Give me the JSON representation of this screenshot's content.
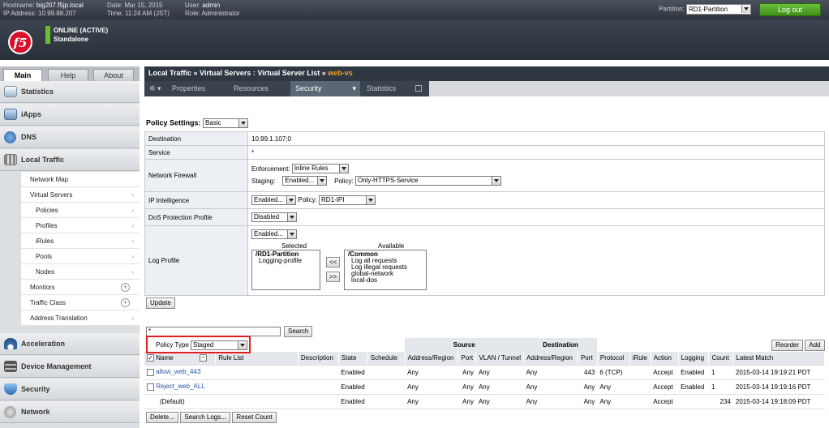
{
  "header": {
    "hostname_label": "Hostname:",
    "hostname": "big207.f5jp.local",
    "ip_label": "IP Address:",
    "ip": "10.99.88.207",
    "date_label": "Date:",
    "date": "Mar 15, 2015",
    "time_label": "Time:",
    "time": "11:24 AM (JST)",
    "user_label": "User:",
    "user": "admin",
    "role_label": "Role:",
    "role": "Administrator",
    "partition_label": "Partition:",
    "partition": "RD1-Partition",
    "logout": "Log out",
    "status_line1": "ONLINE (ACTIVE)",
    "status_line2": "Standalone",
    "logo": "f5"
  },
  "left_tabs": [
    "Main",
    "Help",
    "About"
  ],
  "nav": {
    "statistics": "Statistics",
    "iapps": "iApps",
    "dns": "DNS",
    "local_traffic": "Local Traffic",
    "items": [
      "Network Map",
      "Virtual Servers",
      "Policies",
      "Profiles",
      "iRules",
      "Pools",
      "Nodes",
      "Monitors",
      "Traffic Class",
      "Address Translation"
    ],
    "acceleration": "Acceleration",
    "device_management": "Device Management",
    "security": "Security",
    "network": "Network"
  },
  "breadcrumb": {
    "path": "Local Traffic » Virtual Servers : Virtual Server List »",
    "current": "web-vs"
  },
  "tabs": [
    "Properties",
    "Resources",
    "Security",
    "Statistics"
  ],
  "policy_settings": {
    "label": "Policy Settings:",
    "mode": "Basic"
  },
  "rows": {
    "destination": {
      "label": "Destination",
      "value": "10.99.1.107:0"
    },
    "service": {
      "label": "Service",
      "value": "*"
    },
    "firewall": {
      "label": "Network Firewall",
      "enforcement_label": "Enforcement:",
      "enforcement": "Inline Rules",
      "staging_label": "Staging:",
      "staging": "Enabled...",
      "policy_label": "Policy:",
      "policy": "Only-HTTPS-Service"
    },
    "ip_intel": {
      "label": "IP Intelligence",
      "value": "Enabled...",
      "policy_label": "Policy:",
      "policy": "RD1-IPI"
    },
    "dos": {
      "label": "DoS Protection Profile",
      "value": "Disabled"
    },
    "log": {
      "label": "Log Profile",
      "value": "Enabled...",
      "selected_label": "Selected",
      "available_label": "Available",
      "selected": [
        "/RD1-Partition",
        "Logging-profile"
      ],
      "available": [
        "/Common",
        "Log all requests",
        "Log illegal requests",
        "global-network",
        "local-dos"
      ],
      "move_left": "<<",
      "move_right": ">>"
    }
  },
  "update": "Update",
  "search_button": "Search",
  "search_value": "*",
  "policy_type_label": "Policy Type",
  "policy_type": "Staged",
  "group_headers": {
    "source": "Source",
    "destination": "Destination"
  },
  "reorder": "Reorder",
  "add": "Add",
  "columns": [
    "Name",
    "Rule List",
    "Description",
    "State",
    "Schedule",
    "Address/Region",
    "Port",
    "VLAN / Tunnel",
    "Address/Region",
    "Port",
    "Protocol",
    "iRule",
    "Action",
    "Logging",
    "Count",
    "Latest Match"
  ],
  "rules": [
    {
      "name": "allow_web_443",
      "state": "Enabled",
      "src_addr": "Any",
      "src_port": "Any",
      "vlan": "Any",
      "dst_addr": "Any",
      "dst_port": "443",
      "protocol": "6 (TCP)",
      "action": "Accept",
      "logging": "Enabled",
      "count": "1",
      "latest": "2015-03-14 19:19:21 PDT"
    },
    {
      "name": "Reject_web_ALL",
      "state": "Enabled",
      "src_addr": "Any",
      "src_port": "Any",
      "vlan": "Any",
      "dst_addr": "Any",
      "dst_port": "Any",
      "protocol": "Any",
      "action": "Accept",
      "logging": "Enabled",
      "count": "1",
      "latest": "2015-03-14 19:19:16 PDT"
    },
    {
      "name": "(Default)",
      "state": "Enabled",
      "src_addr": "Any",
      "src_port": "Any",
      "vlan": "Any",
      "dst_addr": "Any",
      "dst_port": "Any",
      "protocol": "Any",
      "action": "Accept",
      "logging": "",
      "count": "234",
      "latest": "2015-03-14 19:18:09 PDT"
    }
  ],
  "footer_buttons": [
    "Delete...",
    "Search Logs...",
    "Reset Count"
  ],
  "colors": {
    "accent_green": "#6abf2c",
    "highlight_red": "#e02020",
    "header_dark": "#2f3742",
    "logo_red": "#d8102b"
  }
}
